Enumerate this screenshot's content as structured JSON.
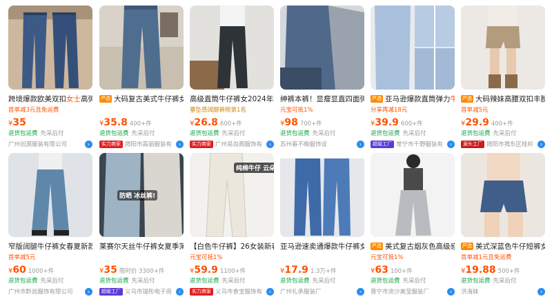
{
  "colors": {
    "accent": "#ff5000",
    "service": "#11a347",
    "muted": "#999999"
  },
  "products": [
    {
      "tag": "",
      "title": "跨境爆款欧美双扣",
      "title_hl": "女士",
      "title_tail": "高弹",
      "promo": "首单减3元且免运费",
      "currency": "¥",
      "price": "35",
      "sold": "",
      "service": "退货包运费",
      "pay": "先采后付",
      "shop_badge": "",
      "shop": "广州创源服装有限公司",
      "thumb_text": ""
    },
    {
      "tag": "严选",
      "title": "大码复古美式牛仔裤女",
      "title_hl": "",
      "title_tail": "",
      "promo": "",
      "currency": "¥",
      "price": "35.8",
      "sold": "400+件",
      "service": "退货包运费",
      "pay": "先采后付",
      "shop_badge": "实力商家",
      "shop": "揭阳市高丽服装有",
      "thumb_text": ""
    },
    {
      "tag": "",
      "title": "高级直筒牛仔裤女2024年爆",
      "title_hl": "",
      "title_tail": "",
      "promo": "垂坠感阔腿裤榜第1名",
      "currency": "¥",
      "price": "26.8",
      "sold": "600+件",
      "service": "退货包运费",
      "pay": "先采后付",
      "shop_badge": "实力商家",
      "shop": "广州易尚阁服饰有",
      "thumb_text": ""
    },
    {
      "tag": "",
      "title": "绅裤本裤！显瘦显直四面弹",
      "title_hl": "",
      "title_tail": "",
      "promo": "元宝可抵1%",
      "currency": "¥",
      "price": "98",
      "sold": "700+件",
      "service": "退货包运费",
      "pay": "先采后付",
      "shop_badge": "",
      "shop": "苏州春不晚服饰设",
      "thumb_text": ""
    },
    {
      "tag": "严选",
      "title": "亚马逊爆款直筒弹力",
      "title_hl": "牛",
      "title_tail": "",
      "promo": "分享再减18元",
      "currency": "¥",
      "price": "39.9",
      "sold": "600+件",
      "service": "退货包运费",
      "pay": "先采后付",
      "shop_badge": "超级工厂",
      "shop": "常宁市千野服装有",
      "thumb_text": ""
    },
    {
      "tag": "严选",
      "title": "大码辣妹高腰双扣丰腴",
      "title_hl": "",
      "title_tail": "",
      "promo": "首单减5元",
      "currency": "¥",
      "price": "29.9",
      "sold": "400+件",
      "service": "退货包运费",
      "pay": "先采后付",
      "shop_badge": "源头工厂",
      "shop": "揭阳市揭东区桂岭",
      "thumb_text": ""
    },
    {
      "tag": "",
      "title": "窄版阔腿牛仔裤女春夏新款",
      "title_hl": "",
      "title_tail": "",
      "promo": "首单减5元",
      "currency": "¥",
      "price": "60",
      "sold": "1000+件",
      "service": "退货包运费",
      "pay": "先采后付",
      "shop_badge": "",
      "shop": "广州市黔尚服饰有限公司",
      "thumb_text": ""
    },
    {
      "tag": "",
      "title": "莱赛尔天丝牛仔裤女夏季薄",
      "title_hl": "",
      "title_tail": "",
      "promo": "",
      "currency": "¥",
      "price": "35",
      "sold": "限时价 3300+件",
      "service": "退货包运费",
      "pay": "先采后付",
      "shop_badge": "超级工厂",
      "shop": "义乌市瑞彤电子商",
      "thumb_text": "防晒 冰丝裤!"
    },
    {
      "tag": "",
      "title": "【白色牛仔裤】26女装新春",
      "title_hl": "",
      "title_tail": "",
      "promo": "元宝可抵1%",
      "currency": "¥",
      "price": "59.9",
      "sold": "1100+件",
      "service": "退货包运费",
      "pay": "先采后付",
      "shop_badge": "实力商家",
      "shop": "义乌市食宝服饰有",
      "thumb_text": "纯棉牛仔 云朵裤"
    },
    {
      "tag": "",
      "title": "亚马逊速卖通爆款牛仔裤女",
      "title_hl": "",
      "title_tail": "",
      "promo": "",
      "currency": "¥",
      "price": "17.9",
      "sold": "1.3万+件",
      "service": "退货包运费",
      "pay": "先采后付",
      "shop_badge": "",
      "shop": "广州礼承服装厂",
      "thumb_text": ""
    },
    {
      "tag": "严选",
      "title": "美式复古烟灰色高级感",
      "title_hl": "",
      "title_tail": "",
      "promo": "元宝可抵1%",
      "currency": "¥",
      "price": "63",
      "sold": "100+件",
      "service": "退货包运费",
      "pay": "先采后付",
      "shop_badge": "",
      "shop": "晋宁市流沙美莹服装厂",
      "thumb_text": ""
    },
    {
      "tag": "严选",
      "title": "美式深蓝色牛仔短裤女",
      "title_hl": "",
      "title_tail": "",
      "promo": "首单减1元且免运费",
      "currency": "¥",
      "price": "19.88",
      "sold": "500+件",
      "service": "退货包运费",
      "pay": "先采后付",
      "shop_badge": "",
      "shop": "洪海妹",
      "thumb_text": ""
    }
  ]
}
